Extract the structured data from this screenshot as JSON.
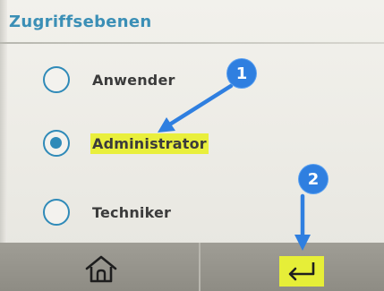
{
  "title": "Zugriffsebenen",
  "options": [
    {
      "label": "Anwender",
      "selected": false
    },
    {
      "label": "Administrator",
      "selected": true
    },
    {
      "label": "Techniker",
      "selected": false
    }
  ],
  "annotations": {
    "badge1": "1",
    "badge2": "2"
  },
  "colors": {
    "accent": "#2f8ab8",
    "highlight": "#e9ef3c",
    "annotation": "#2f7fe0",
    "navbar": "#96948c"
  },
  "nav": {
    "home_icon": "home-icon",
    "back_icon": "return-arrow-icon"
  }
}
